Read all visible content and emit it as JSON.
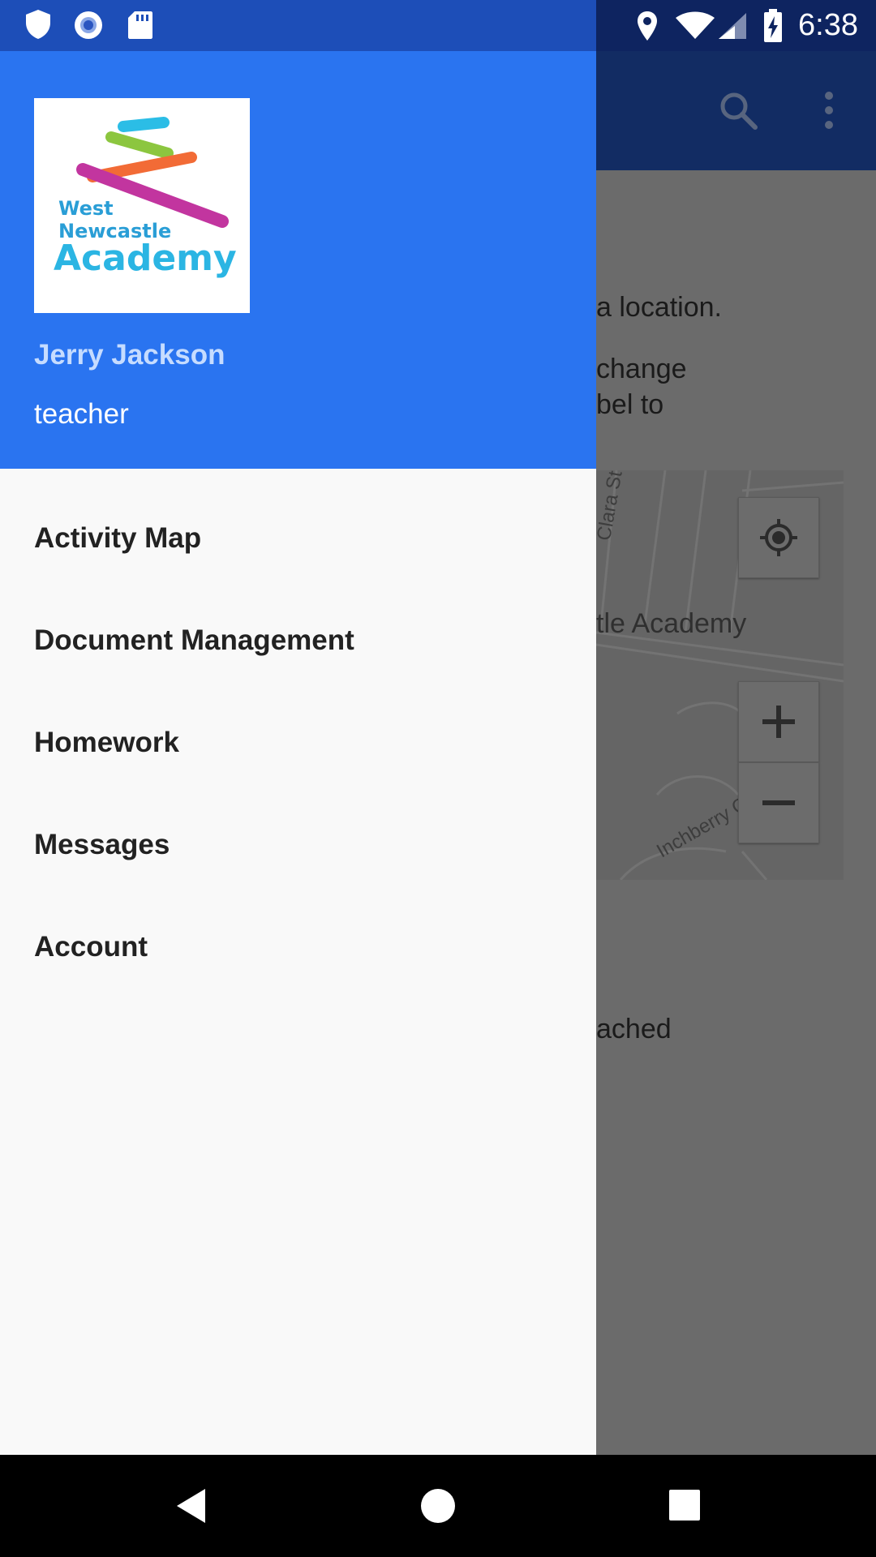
{
  "status_bar": {
    "time": "6:38",
    "icons": [
      "shield-icon",
      "record-icon",
      "sd-card-icon",
      "location-icon",
      "wifi-icon",
      "signal-icon",
      "battery-charging-icon"
    ]
  },
  "background_app": {
    "toolbar_icons": [
      "search-icon",
      "more-vert-icon"
    ],
    "text_line_1": "a location.",
    "text_line_2": "change",
    "text_line_3": "bel to",
    "text_line_4": "ached",
    "map": {
      "street_1": "Clara St",
      "street_2": "Inchberry Cl",
      "place_label": "tle Academy",
      "zoom_in": "+",
      "zoom_out": "−"
    }
  },
  "drawer": {
    "logo": {
      "line_1": "West",
      "line_2": "Newcastle",
      "line_3": "Academy"
    },
    "user_name": "Jerry Jackson",
    "user_role": "teacher",
    "items": [
      {
        "label": "Activity Map"
      },
      {
        "label": "Document Management"
      },
      {
        "label": "Homework"
      },
      {
        "label": "Messages"
      },
      {
        "label": "Account"
      }
    ]
  },
  "nav_bar": {
    "icons": [
      "back-icon",
      "home-icon",
      "recents-icon"
    ]
  },
  "colors": {
    "header_blue": "#2a74f0",
    "status_blue": "#1d4eb8",
    "drawer_bg": "#f9f9f9"
  }
}
